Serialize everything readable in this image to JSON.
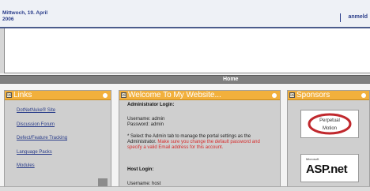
{
  "header": {
    "date_line1": "Mittwoch, 19. April",
    "date_line2": "2006",
    "user_name": "anmeld"
  },
  "menu": {
    "home": "Home"
  },
  "panes": {
    "links": {
      "title": "Links",
      "items": [
        "DotNetNuke® Site",
        "Discussion Forum",
        "Defect/Feature Tracking",
        "Language Packs",
        "Modules"
      ]
    },
    "welcome": {
      "title": "Welcome To My Website...",
      "admin_heading": "Administrator Login:",
      "admin_username": "Username: admin",
      "admin_password": "Password: admin",
      "info_text": "* Select the Admin tab to manage the portal settings as the Administrator.",
      "warning_text": "Make sure you change the default password and specify a valid Email address for this account.",
      "host_heading": "Host Login:",
      "host_username": "Username: host"
    },
    "sponsors": {
      "title": "Sponsors",
      "sponsor1_logo": "Perpetual Motion",
      "sponsor2_logo": "ASP.net",
      "sponsor2_caption": "Microsoft"
    }
  },
  "colors": {
    "pane_header": "#f2b03c",
    "link": "#2a3d8a",
    "warning": "#d62c2c",
    "menubar": "#7f7f7f"
  }
}
